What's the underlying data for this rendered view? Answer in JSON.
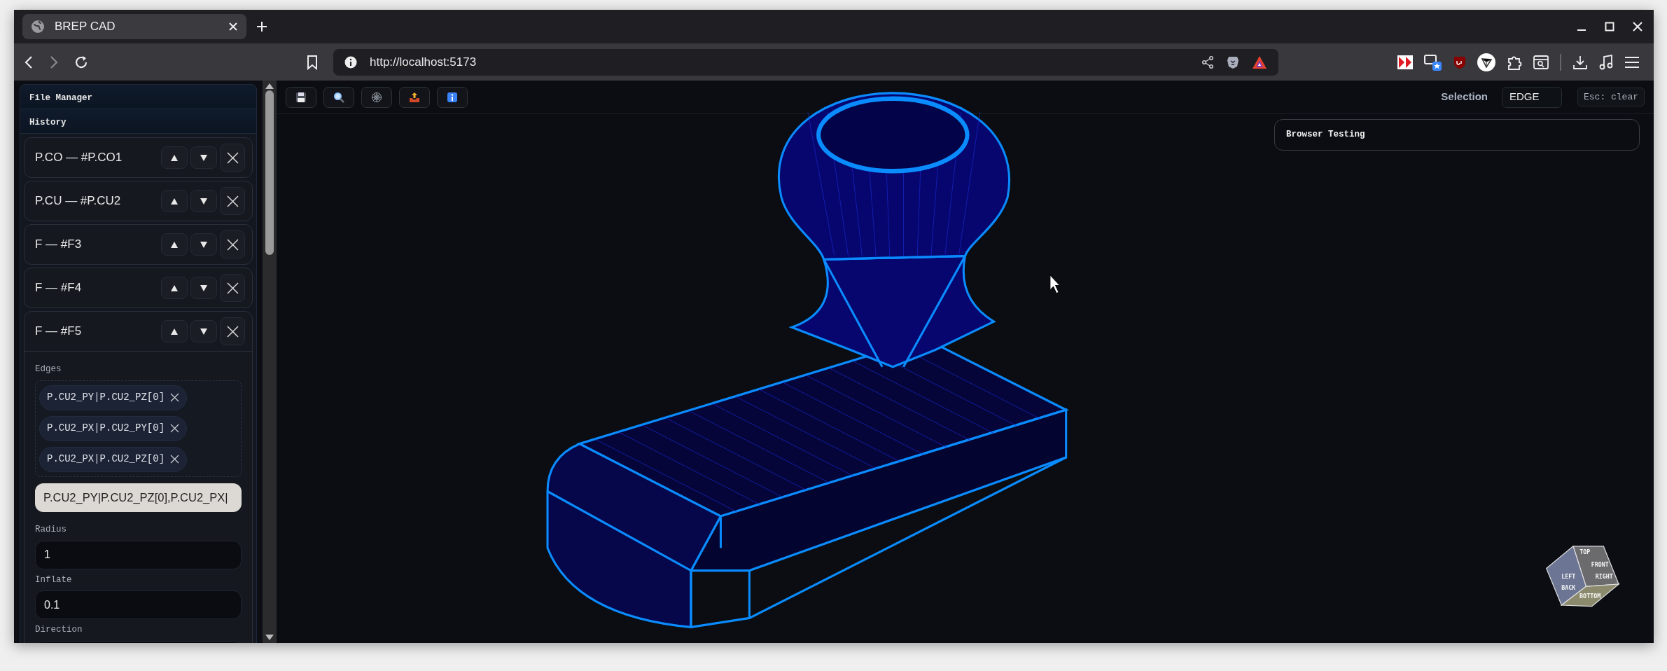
{
  "browser": {
    "tab_title": "BREP CAD",
    "url": "http://localhost:5173"
  },
  "sidebar": {
    "sections": [
      {
        "title": "File Manager"
      },
      {
        "title": "History"
      }
    ],
    "history": [
      {
        "label": "P.CO — #P.CO1",
        "expanded": false
      },
      {
        "label": "P.CU — #P.CU2",
        "expanded": false
      },
      {
        "label": "F — #F3",
        "expanded": false
      },
      {
        "label": "F — #F4",
        "expanded": false
      },
      {
        "label": "F — #F5",
        "expanded": true,
        "params": [
          {
            "kind": "edges",
            "label": "Edges",
            "chips": [
              "P.CU2_PY|P.CU2_PZ[0]",
              "P.CU2_PX|P.CU2_PY[0]",
              "P.CU2_PX|P.CU2_PZ[0]"
            ],
            "value": "P.CU2_PY|P.CU2_PZ[0],P.CU2_PX|"
          },
          {
            "kind": "input",
            "label": "Radius",
            "value": "1"
          },
          {
            "kind": "input",
            "label": "Inflate",
            "value": "0.1"
          },
          {
            "kind": "input",
            "label": "Direction"
          }
        ]
      }
    ]
  },
  "viewport": {
    "selection": {
      "label": "Selection",
      "mode": "EDGE",
      "hint": "Esc: clear"
    },
    "panel": {
      "title": "Browser Testing"
    },
    "view_cube": {
      "faces": [
        "TOP",
        "FRONT",
        "LEFT",
        "RIGHT",
        "BACK",
        "BOTTOM"
      ]
    }
  }
}
